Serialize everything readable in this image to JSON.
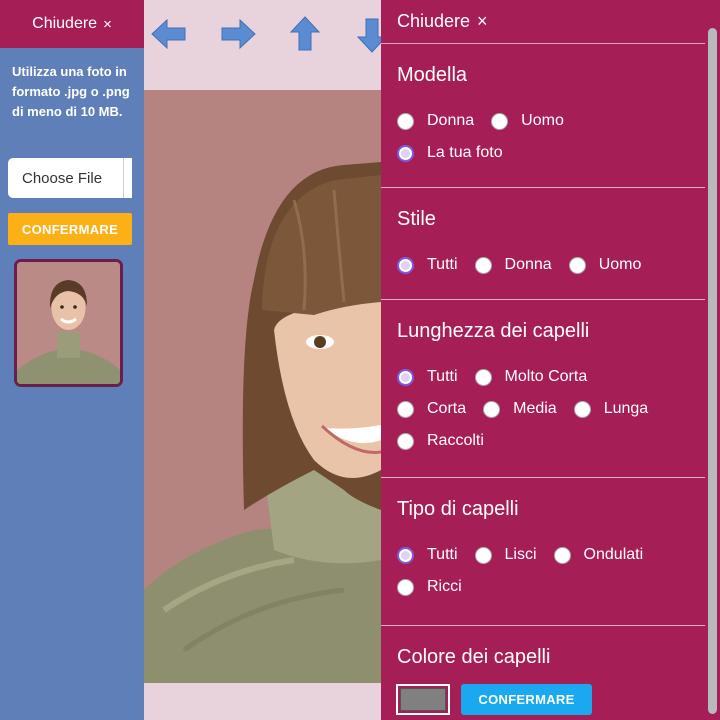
{
  "left_panel": {
    "close_label": "Chiudere",
    "close_symbol": "×",
    "upload_hint": "Utilizza una foto in formato .jpg o .png di meno di 10 MB.",
    "file_button_label": "Choose File",
    "confirm_label": "CONFERMARE"
  },
  "toolbar": {
    "icons": [
      "arrow-left-icon",
      "arrow-right-icon",
      "arrow-up-icon",
      "arrow-down-icon"
    ]
  },
  "right_panel": {
    "close_label": "Chiudere",
    "close_symbol": "×",
    "sections": {
      "modella": {
        "title": "Modella",
        "options": [
          "Donna",
          "Uomo",
          "La tua foto"
        ],
        "selected": "La tua foto"
      },
      "stile": {
        "title": "Stile",
        "options": [
          "Tutti",
          "Donna",
          "Uomo"
        ],
        "selected": "Tutti"
      },
      "lunghezza": {
        "title": "Lunghezza dei capelli",
        "options": [
          "Tutti",
          "Molto Corta",
          "Corta",
          "Media",
          "Lunga",
          "Raccolti"
        ],
        "selected": "Tutti"
      },
      "tipo": {
        "title": "Tipo di capelli",
        "options": [
          "Tutti",
          "Lisci",
          "Ondulati",
          "Ricci"
        ],
        "selected": "Tutti"
      },
      "colore": {
        "title": "Colore dei capelli",
        "swatch_color": "#808080"
      }
    },
    "confirm_label": "CONFERMARE"
  },
  "colors": {
    "panel_magenta": "#a61e56",
    "sidebar_blue": "#5f7fb8",
    "confirm_orange": "#fbb016",
    "confirm_blue": "#1aa9f0",
    "arrow_blue": "#5b8bd0"
  }
}
